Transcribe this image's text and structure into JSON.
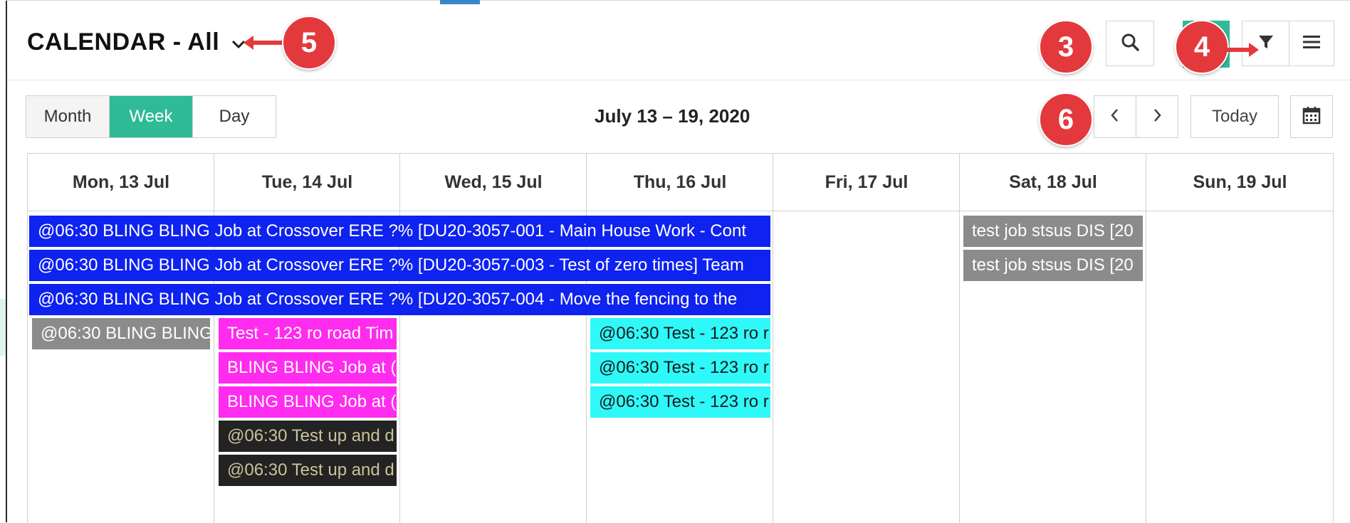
{
  "header": {
    "title": "CALENDAR - All",
    "caret_icon": "chevron-down-icon",
    "search_icon": "search-icon",
    "filter_icon": "filter-icon",
    "menu_icon": "hamburger-menu-icon",
    "accent_color": "#2ebb96"
  },
  "annotations": {
    "badge_3": "3",
    "badge_4": "4",
    "badge_5": "5",
    "badge_6": "6",
    "badge_color": "#e4393c"
  },
  "toolbar": {
    "views": [
      "Month",
      "Week",
      "Day"
    ],
    "active_view": "Week",
    "range_label": "July 13 – 19, 2020",
    "prev_icon": "chevron-left-icon",
    "next_icon": "chevron-right-icon",
    "today_label": "Today",
    "calendar_icon": "calendar-icon"
  },
  "days": [
    "Mon, 13 Jul",
    "Tue, 14 Jul",
    "Wed, 15 Jul",
    "Thu, 16 Jul",
    "Fri, 17 Jul",
    "Sat, 18 Jul",
    "Sun, 19 Jul"
  ],
  "events": {
    "spanning": [
      {
        "text": "@06:30 BLING BLING Job at Crossover ERE ?% [DU20-3057-001 - Main House Work - Cont",
        "color": "#0e22f0"
      },
      {
        "text": "@06:30 BLING BLING Job at Crossover ERE ?% [DU20-3057-003 - Test of zero times] Team",
        "color": "#0e22f0"
      },
      {
        "text": "@06:30 BLING BLING Job at Crossover ERE ?% [DU20-3057-004 - Move the fencing to the",
        "color": "#0e22f0"
      }
    ],
    "mon": [
      {
        "text": "@06:30 BLING BLING",
        "color": "#8b8b8b"
      }
    ],
    "tue": [
      {
        "text": "Test - 123 ro road Tim",
        "color": "#ff2bef"
      },
      {
        "text": "BLING BLING Job at (",
        "color": "#ff2bef"
      },
      {
        "text": "BLING BLING Job at (",
        "color": "#ff2bef"
      },
      {
        "text": "@06:30 Test up and d",
        "color": "#232323"
      },
      {
        "text": "@06:30 Test up and d",
        "color": "#232323"
      }
    ],
    "thu": [
      {
        "text": "@06:30 Test - 123 ro r",
        "color": "#2ff8f8"
      },
      {
        "text": "@06:30 Test - 123 ro r",
        "color": "#2ff8f8"
      },
      {
        "text": "@06:30 Test - 123 ro r",
        "color": "#2ff8f8"
      }
    ],
    "sat": [
      {
        "text": "test job stsus DIS [20",
        "color": "#8b8b8b"
      },
      {
        "text": "test job stsus DIS [20",
        "color": "#8b8b8b"
      }
    ]
  }
}
